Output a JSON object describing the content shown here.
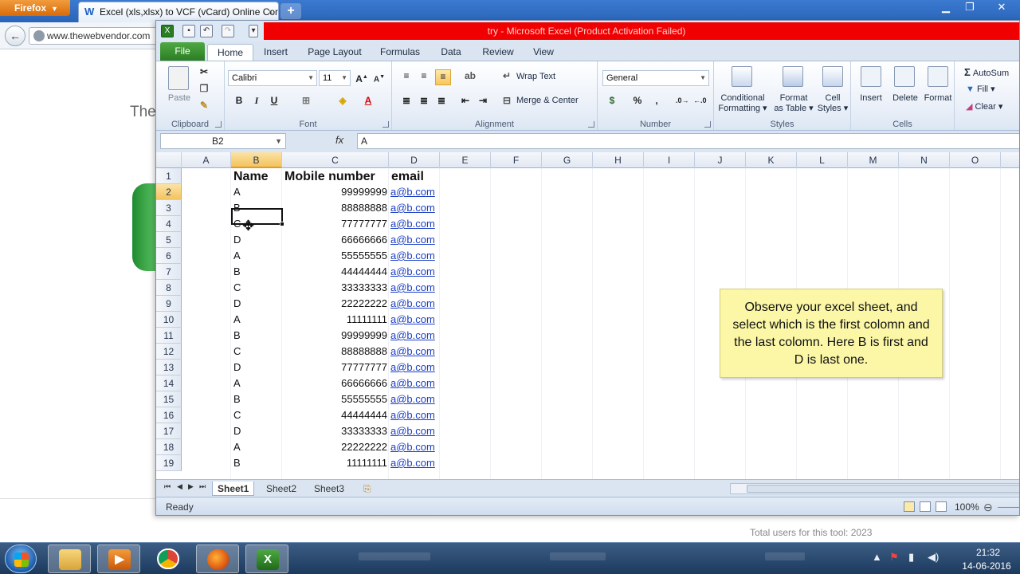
{
  "browser": {
    "menu_label": "Firefox",
    "tab_title": "Excel (xls,xlsx) to VCF (vCard) Online Con...",
    "tab_close": "×",
    "new_tab": "+",
    "url": "www.thewebvendor.com",
    "page_heading_fragment": "The",
    "total_users": "Total users for this tool: 2023"
  },
  "excel": {
    "title": "try  -  Microsoft Excel (Product Activation Failed)",
    "tabs": [
      "File",
      "Home",
      "Insert",
      "Page Layout",
      "Formulas",
      "Data",
      "Review",
      "View"
    ],
    "ribbon": {
      "clipboard": {
        "label": "Clipboard",
        "paste": "Paste"
      },
      "font": {
        "label": "Font",
        "name": "Calibri",
        "size": "11",
        "bold": "B",
        "italic": "I",
        "underline": "U"
      },
      "alignment": {
        "label": "Alignment",
        "wrap": "Wrap Text",
        "merge": "Merge & Center"
      },
      "number": {
        "label": "Number",
        "format": "General",
        "percent": "%",
        "comma": ","
      },
      "styles": {
        "label": "Styles",
        "conditional": [
          "Conditional",
          "Formatting"
        ],
        "format_table": [
          "Format",
          "as Table"
        ],
        "cell_styles": [
          "Cell",
          "Styles"
        ]
      },
      "cells": {
        "label": "Cells",
        "insert": "Insert",
        "delete": "Delete",
        "format": "Format"
      },
      "editing": {
        "autosum": "AutoSum",
        "fill": "Fill",
        "clear": "Clear"
      }
    },
    "name_box": "B2",
    "fx": "fx",
    "formula": "A",
    "columns": [
      "A",
      "B",
      "C",
      "D",
      "E",
      "F",
      "G",
      "H",
      "I",
      "J",
      "K",
      "L",
      "M",
      "N",
      "O"
    ],
    "headers": {
      "name": "Name",
      "mobile": "Mobile number",
      "email": "email"
    },
    "rows": [
      {
        "n": "2",
        "name": "A",
        "mobile": "99999999",
        "email": "a@b.com"
      },
      {
        "n": "3",
        "name": "B",
        "mobile": "88888888",
        "email": "a@b.com"
      },
      {
        "n": "4",
        "name": "C",
        "mobile": "77777777",
        "email": "a@b.com"
      },
      {
        "n": "5",
        "name": "D",
        "mobile": "66666666",
        "email": "a@b.com"
      },
      {
        "n": "6",
        "name": "A",
        "mobile": "55555555",
        "email": "a@b.com"
      },
      {
        "n": "7",
        "name": "B",
        "mobile": "44444444",
        "email": "a@b.com"
      },
      {
        "n": "8",
        "name": "C",
        "mobile": "33333333",
        "email": "a@b.com"
      },
      {
        "n": "9",
        "name": "D",
        "mobile": "22222222",
        "email": "a@b.com"
      },
      {
        "n": "10",
        "name": "A",
        "mobile": "11111111",
        "email": "a@b.com"
      },
      {
        "n": "11",
        "name": "B",
        "mobile": "99999999",
        "email": "a@b.com"
      },
      {
        "n": "12",
        "name": "C",
        "mobile": "88888888",
        "email": "a@b.com"
      },
      {
        "n": "13",
        "name": "D",
        "mobile": "77777777",
        "email": "a@b.com"
      },
      {
        "n": "14",
        "name": "A",
        "mobile": "66666666",
        "email": "a@b.com"
      },
      {
        "n": "15",
        "name": "B",
        "mobile": "55555555",
        "email": "a@b.com"
      },
      {
        "n": "16",
        "name": "C",
        "mobile": "44444444",
        "email": "a@b.com"
      },
      {
        "n": "17",
        "name": "D",
        "mobile": "33333333",
        "email": "a@b.com"
      },
      {
        "n": "18",
        "name": "A",
        "mobile": "22222222",
        "email": "a@b.com"
      },
      {
        "n": "19",
        "name": "B",
        "mobile": "11111111",
        "email": "a@b.com"
      }
    ],
    "note": "Observe your excel sheet, and select which is the first colomn and the last colomn. Here B is first and D is last one.",
    "sheets": [
      "Sheet1",
      "Sheet2",
      "Sheet3"
    ],
    "status": "Ready",
    "zoom": "100%"
  },
  "taskbar": {
    "time": "21:32",
    "date": "14-06-2016"
  },
  "colors": {
    "title_bar_error": "#f00000",
    "file_tab": "#2b7d22",
    "selected_header": "#f4c35e",
    "link": "#1c3ec4",
    "note_bg": "#fbf7a7"
  }
}
